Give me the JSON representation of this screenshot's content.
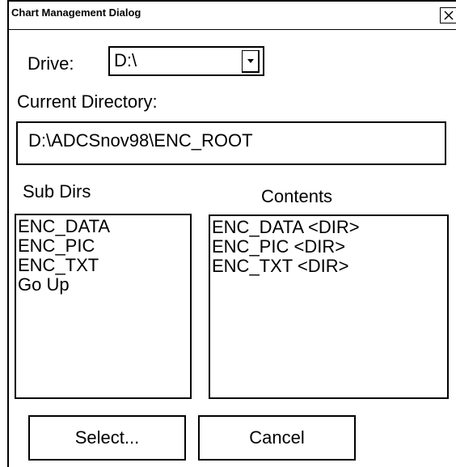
{
  "window": {
    "title": "Chart Management Dialog",
    "close_icon": "close-x-icon"
  },
  "drive": {
    "label": "Drive:",
    "value": "D:\\",
    "dropdown_icon": "chevron-down-icon"
  },
  "current_directory": {
    "label": "Current Directory:",
    "value": "D:\\ADCSnov98\\ENC_ROOT"
  },
  "sub_dirs": {
    "label": "Sub Dirs",
    "items": [
      "ENC_DATA",
      "ENC_PIC",
      "ENC_TXT",
      "Go Up"
    ]
  },
  "contents": {
    "label": "Contents",
    "items": [
      "ENC_DATA <DIR>",
      "ENC_PIC <DIR>",
      "ENC_TXT <DIR>"
    ]
  },
  "buttons": {
    "select": "Select...",
    "cancel": "Cancel"
  }
}
